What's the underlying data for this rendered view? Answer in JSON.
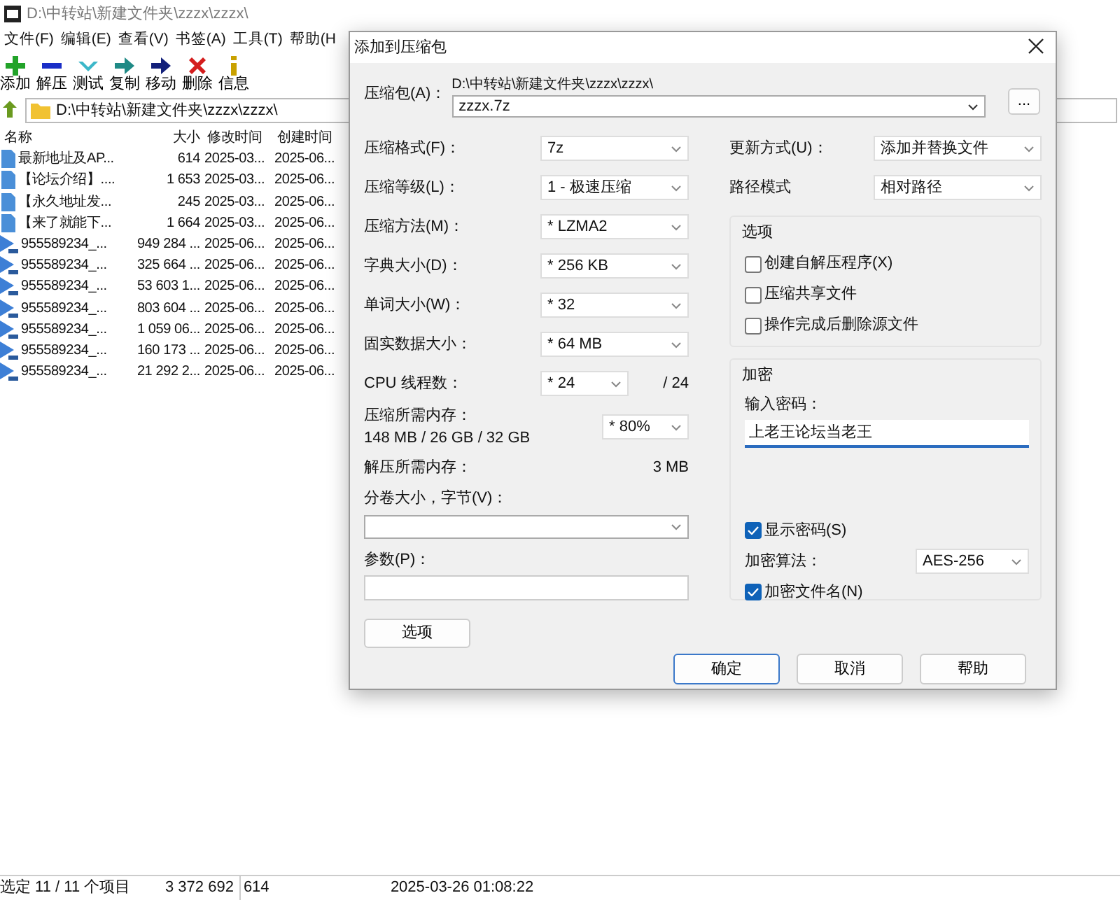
{
  "window": {
    "title": "D:\\中转站\\新建文件夹\\zzzx\\zzzx\\"
  },
  "menu": [
    "文件(F)",
    "编辑(E)",
    "查看(V)",
    "书签(A)",
    "工具(T)",
    "帮助(H"
  ],
  "toolbar": [
    {
      "label": "添加",
      "kind": "add"
    },
    {
      "label": "解压",
      "kind": "extract"
    },
    {
      "label": "测试",
      "kind": "test"
    },
    {
      "label": "复制",
      "kind": "copy"
    },
    {
      "label": "移动",
      "kind": "move"
    },
    {
      "label": "删除",
      "kind": "delete"
    },
    {
      "label": "信息",
      "kind": "info"
    }
  ],
  "address": "D:\\中转站\\新建文件夹\\zzzx\\zzzx\\",
  "file_list": {
    "columns": [
      "名称",
      "大小",
      "修改时间",
      "创建时间"
    ],
    "rows": [
      {
        "kind": "document",
        "cells": [
          "最新地址及AP...",
          "614",
          "2025-03...",
          "2025-06..."
        ]
      },
      {
        "kind": "document",
        "cells": [
          "【论坛介绍】....",
          "1 653",
          "2025-03...",
          "2025-06..."
        ]
      },
      {
        "kind": "document",
        "cells": [
          "【永久地址发...",
          "245",
          "2025-03...",
          "2025-06..."
        ]
      },
      {
        "kind": "document",
        "cells": [
          "【来了就能下...",
          "1 664",
          "2025-03...",
          "2025-06..."
        ]
      },
      {
        "kind": "video",
        "cells": [
          "955589234_...",
          "949 284 ...",
          "2025-06...",
          "2025-06..."
        ]
      },
      {
        "kind": "video",
        "cells": [
          "955589234_...",
          "325 664 ...",
          "2025-06...",
          "2025-06..."
        ]
      },
      {
        "kind": "video",
        "cells": [
          "955589234_...",
          "53 603 1...",
          "2025-06...",
          "2025-06..."
        ]
      },
      {
        "kind": "video",
        "cells": [
          "955589234_...",
          "803 604 ...",
          "2025-06...",
          "2025-06..."
        ]
      },
      {
        "kind": "video",
        "cells": [
          "955589234_...",
          "1 059 06...",
          "2025-06...",
          "2025-06..."
        ]
      },
      {
        "kind": "video",
        "cells": [
          "955589234_...",
          "160 173 ...",
          "2025-06...",
          "2025-06..."
        ]
      },
      {
        "kind": "video",
        "cells": [
          "955589234_...",
          "21 292 2...",
          "2025-06...",
          "2025-06..."
        ]
      }
    ]
  },
  "status_bar": [
    "选定 11 / 11 个项目",
    "3 372 692",
    "614",
    "2025-03-26 01:08:22"
  ],
  "dialog": {
    "title": "添加到压缩包",
    "archive": {
      "label": "压缩包(A)：",
      "folder": "D:\\中转站\\新建文件夹\\zzzx\\zzzx\\",
      "value": "zzzx.7z",
      "browse": "..."
    },
    "settings": [
      {
        "label": "压缩格式(F)：",
        "value": "7z"
      },
      {
        "label": "压缩等级(L)：",
        "value": "1 - 极速压缩"
      },
      {
        "label": "压缩方法(M)：",
        "value": "* LZMA2"
      },
      {
        "label": "字典大小(D)：",
        "value": "* 256 KB"
      },
      {
        "label": "单词大小(W)：",
        "value": "* 32"
      },
      {
        "label": "固实数据大小：",
        "value": "* 64 MB"
      }
    ],
    "cpu": {
      "label": "CPU 线程数：",
      "value": "* 24",
      "total": "/ 24"
    },
    "memory": {
      "label": "压缩所需内存：",
      "usage": "148 MB / 26 GB / 32 GB",
      "value": "* 80%"
    },
    "decompress_memory": {
      "label": "解压所需内存：",
      "value": "3 MB"
    },
    "volume": {
      "label": "分卷大小，字节(V)："
    },
    "parameters": {
      "label": "参数(P)："
    },
    "options_button": "选项",
    "update": {
      "label": "更新方式(U)：",
      "value": "添加并替换文件"
    },
    "path_mode": {
      "label": "路径模式",
      "value": "相对路径"
    },
    "options": {
      "title": "选项",
      "items": [
        {
          "label": "创建自解压程序(X)",
          "checked": false
        },
        {
          "label": "压缩共享文件",
          "checked": false
        },
        {
          "label": "操作完成后删除源文件",
          "checked": false
        }
      ]
    },
    "encryption": {
      "title": "加密",
      "password_label": "输入密码：",
      "password": "上老王论坛当老王",
      "focused": true,
      "show_password": {
        "label": "显示密码(S)",
        "checked": true
      },
      "method": {
        "label": "加密算法：",
        "value": "AES-256"
      },
      "encrypt_names": {
        "label": "加密文件名(N)",
        "checked": true
      }
    },
    "buttons": [
      {
        "label": "确定",
        "default": true
      },
      {
        "label": "取消",
        "default": false
      },
      {
        "label": "帮助",
        "default": false
      }
    ]
  }
}
